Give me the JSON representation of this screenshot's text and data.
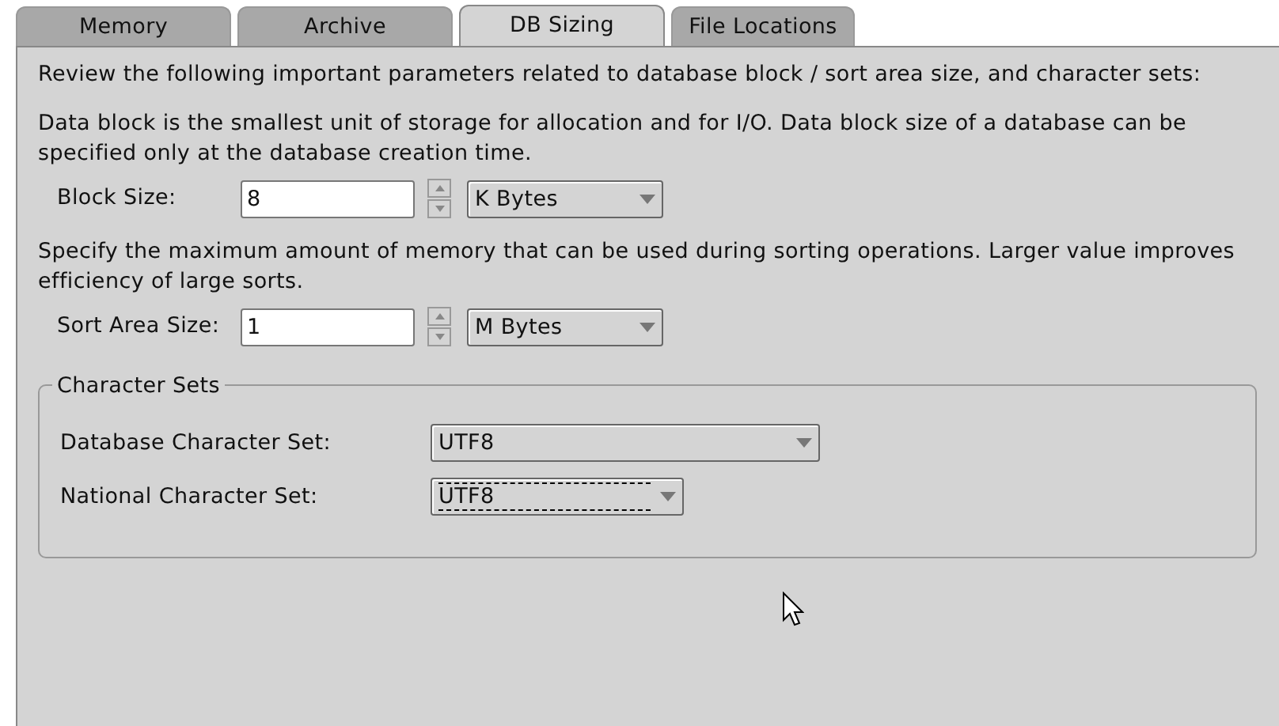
{
  "tabs": [
    {
      "label": "Memory",
      "selected": false
    },
    {
      "label": "Archive",
      "selected": false
    },
    {
      "label": "DB Sizing",
      "selected": true
    },
    {
      "label": "File Locations",
      "selected": false
    }
  ],
  "intro": "Review the following important parameters related to database block / sort area size, and character sets:",
  "sections": [
    {
      "description": "Data block is the smallest unit of storage for allocation and for I/O. Data block size of a database can be specified only at the database creation time.",
      "label": "Block Size:",
      "value": "8",
      "unit": "K Bytes"
    },
    {
      "description": "Specify the maximum amount of memory that can be used during sorting operations. Larger value improves efficiency of large sorts.",
      "label": "Sort Area Size:",
      "value": "1",
      "unit": "M Bytes"
    }
  ],
  "character_sets": {
    "title": "Character Sets",
    "fields": [
      {
        "label": "Database Character Set:",
        "value": "UTF8",
        "focused": false,
        "wide": true
      },
      {
        "label": "National Character Set:",
        "value": "UTF8",
        "focused": true,
        "wide": false
      }
    ]
  }
}
